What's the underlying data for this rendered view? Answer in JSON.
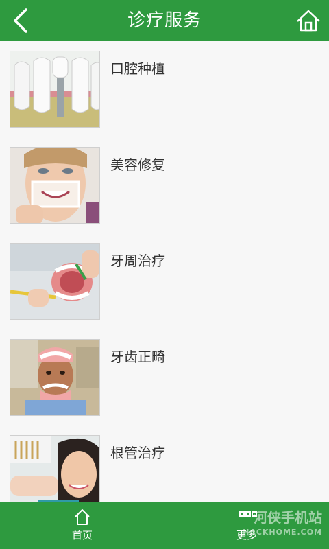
{
  "header": {
    "title": "诊疗服务",
    "back_icon": "chevron-left-icon",
    "home_icon": "home-icon"
  },
  "services": [
    {
      "label": "口腔种植",
      "image": "dental-implant-image"
    },
    {
      "label": "美容修复",
      "image": "smile-photo-image"
    },
    {
      "label": "牙周治疗",
      "image": "brushing-model-image"
    },
    {
      "label": "牙齿正畸",
      "image": "child-with-model-image"
    },
    {
      "label": "根管治疗",
      "image": "woman-dentist-image"
    }
  ],
  "bottom_nav": {
    "home_label": "首页",
    "more_label": "更多"
  },
  "watermark": {
    "text": "河侠手机站",
    "sub": "HACKHOME.COM"
  },
  "colors": {
    "brand": "#2e9a3f",
    "background": "#f7f7f7"
  }
}
